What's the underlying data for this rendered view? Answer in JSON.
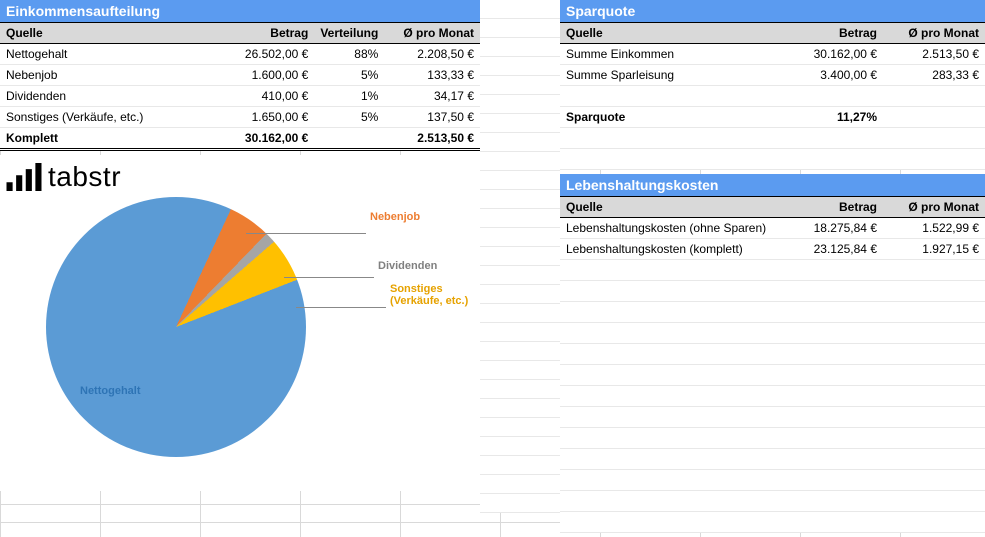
{
  "left": {
    "title": "Einkommensaufteilung",
    "headers": [
      "Quelle",
      "Betrag",
      "Verteilung",
      "Ø pro Monat"
    ],
    "rows": [
      {
        "quelle": "Nettogehalt",
        "betrag": "26.502,00 €",
        "verteilung": "88%",
        "monat": "2.208,50 €"
      },
      {
        "quelle": "Nebenjob",
        "betrag": "1.600,00 €",
        "verteilung": "5%",
        "monat": "133,33 €"
      },
      {
        "quelle": "Dividenden",
        "betrag": "410,00 €",
        "verteilung": "1%",
        "monat": "34,17 €"
      },
      {
        "quelle": "Sonstiges (Verkäufe, etc.)",
        "betrag": "1.650,00 €",
        "verteilung": "5%",
        "monat": "137,50 €"
      }
    ],
    "total": {
      "quelle": "Komplett",
      "betrag": "30.162,00 €",
      "verteilung": "",
      "monat": "2.513,50 €"
    }
  },
  "right1": {
    "title": "Sparquote",
    "headers": [
      "Quelle",
      "Betrag",
      "Ø pro Monat"
    ],
    "rows": [
      {
        "quelle": "Summe Einkommen",
        "betrag": "30.162,00 €",
        "monat": "2.513,50 €"
      },
      {
        "quelle": "Summe Sparleisung",
        "betrag": "3.400,00 €",
        "monat": "283,33 €"
      }
    ],
    "quote": {
      "label": "Sparquote",
      "value": "11,27%"
    }
  },
  "right2": {
    "title": "Lebenshaltungskosten",
    "headers": [
      "Quelle",
      "Betrag",
      "Ø pro Monat"
    ],
    "rows": [
      {
        "quelle": "Lebenshaltungskosten (ohne Sparen)",
        "betrag": "18.275,84 €",
        "monat": "1.522,99 €"
      },
      {
        "quelle": "Lebenshaltungskosten (komplett)",
        "betrag": "23.125,84 €",
        "monat": "1.927,15 €"
      }
    ]
  },
  "logo": "tabstr",
  "chart_data": {
    "type": "pie",
    "title": "",
    "categories": [
      "Nettogehalt",
      "Nebenjob",
      "Dividenden",
      "Sonstiges (Verkäufe, etc.)"
    ],
    "values": [
      26502.0,
      1600.0,
      410.0,
      1650.0
    ],
    "percent": [
      88,
      5,
      1,
      5
    ],
    "colors": [
      "#5b9bd5",
      "#ed7d31",
      "#a5a5a5",
      "#ffc000"
    ],
    "labels": {
      "netto": "Nettogehalt",
      "neben": "Nebenjob",
      "div": "Dividenden",
      "sonst": "Sonstiges\n(Verkäufe, etc.)"
    }
  }
}
